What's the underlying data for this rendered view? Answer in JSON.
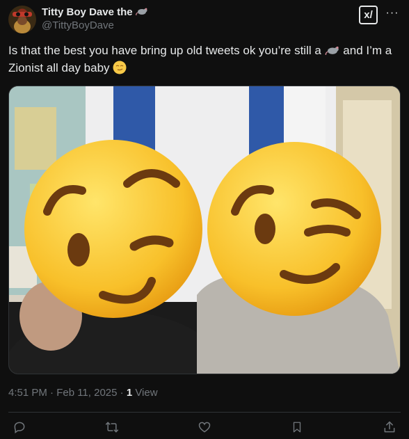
{
  "author": {
    "display_name": "Titty Boy Dave the",
    "handle": "@TittyBoyDave",
    "name_emoji_icon": "rat-icon"
  },
  "toolbar": {
    "grok_label": "x/",
    "more_label": "···"
  },
  "tweet": {
    "text_part1": "Is that the best you have bring up old tweets ok you’re still a",
    "text_part2": "and I’m a Zionist all day baby",
    "inline_emoji_1": "rat-icon",
    "inline_emoji_2": "smirk-face-icon"
  },
  "meta": {
    "time": "4:51 PM · Feb 11, 2025 · ",
    "views_count": "1",
    "views_label": " View"
  },
  "actions": [
    "reply-icon",
    "retweet-icon",
    "like-icon",
    "bookmark-icon",
    "share-icon"
  ],
  "colors": {
    "background": "#0f0f0f",
    "text": "#e7e9ea",
    "secondary": "#71767b",
    "border": "#2f3336"
  }
}
